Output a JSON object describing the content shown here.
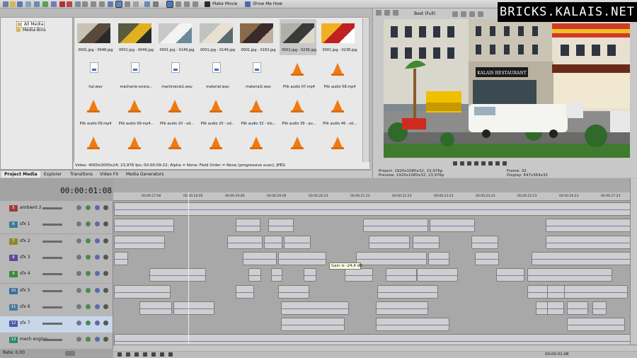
{
  "watermark": "BRICKS.KALAIS.NET",
  "toolbar": {
    "make_movie": "Make Movie",
    "show_me_how": "Show Me How"
  },
  "preview_toolbar": {
    "quality": "Best (Full)"
  },
  "tree": {
    "items": [
      "All Media",
      "Media Bins"
    ]
  },
  "media": {
    "items": [
      {
        "name": "0001.jpg - 0048.jpg",
        "kind": "thumb"
      },
      {
        "name": "0001.jpg - 0049.jpg",
        "kind": "thumb"
      },
      {
        "name": "0001.jpg - 0149.jpg",
        "kind": "thumb"
      },
      {
        "name": "0001.jpg - 0149.jpg",
        "kind": "thumb"
      },
      {
        "name": "0001.jpg - 0163.jpg",
        "kind": "thumb"
      },
      {
        "name": "0001.jpg - 0236.jpg",
        "kind": "thumb"
      },
      {
        "name": "0001.jpg - 0238.jpg",
        "kind": "thumb"
      },
      {
        "name": "hal.wav",
        "kind": "wav"
      },
      {
        "name": "machanie-sciera...",
        "kind": "wav"
      },
      {
        "name": "machniecie1.wav",
        "kind": "wav"
      },
      {
        "name": "material.wav",
        "kind": "wav"
      },
      {
        "name": "material2.wav",
        "kind": "wav"
      },
      {
        "name": "Plik audio 07.mp4",
        "kind": "cone"
      },
      {
        "name": "Plik audio 08.mp4",
        "kind": "cone"
      },
      {
        "name": "Plik audio 09.mp4",
        "kind": "cone"
      },
      {
        "name": "Plik audio 09.mp4...",
        "kind": "cone"
      },
      {
        "name": "Plik audio 20 - od...",
        "kind": "cone"
      },
      {
        "name": "Plik audio 20 - od...",
        "kind": "cone"
      },
      {
        "name": "Plik audio 32 - klo...",
        "kind": "cone"
      },
      {
        "name": "Plik audio 39 - pu...",
        "kind": "cone"
      },
      {
        "name": "Plik audio 46 - zd...",
        "kind": "cone"
      },
      {
        "name": "",
        "kind": "cone"
      },
      {
        "name": "",
        "kind": "cone"
      },
      {
        "name": "",
        "kind": "cone"
      },
      {
        "name": "",
        "kind": "cone"
      },
      {
        "name": "",
        "kind": "cone"
      },
      {
        "name": "",
        "kind": "cone"
      },
      {
        "name": "",
        "kind": "cone"
      }
    ],
    "status": "Video: 4000x3000x24; 23,976 fps; 00:00:09:22; Alpha = None; Field Order = None (progressive scan); JPEG"
  },
  "tabs": [
    "Project Media",
    "Explorer",
    "Transitions",
    "Video FX",
    "Media Generators"
  ],
  "preview": {
    "sign": "KALAIS RESTAURANT",
    "project": "Project:  1920x1080x32; 23,976p",
    "preview": "Preview:  1920x1080x32; 23,976p",
    "frame": "Frame:        32",
    "display": "Display:      647x364x32"
  },
  "timeline": {
    "timecode": "00:00:01:08",
    "ruler": [
      "00:00:17:00",
      "00:00:18:00",
      "00:00:19:00",
      "00:00:20:00",
      "00:00:20:23",
      "00:00:21:23",
      "00:00:22:23",
      "00:00:23:23",
      "00:00:24:23",
      "00:00:25:23",
      "00:00:26:23",
      "00:00:27:23"
    ],
    "tracks": [
      {
        "num": "5",
        "name": "ambient 2",
        "color": "#a03b3b"
      },
      {
        "num": "6",
        "name": "sfx 1",
        "color": "#3b7d9a"
      },
      {
        "num": "7",
        "name": "sfx 2",
        "color": "#8a8a2a"
      },
      {
        "num": "8",
        "name": "sfx 3",
        "color": "#5a4a9a"
      },
      {
        "num": "9",
        "name": "sfx 4",
        "color": "#3a8a3a"
      },
      {
        "num": "10",
        "name": "sfx 5",
        "color": "#3b6d9a"
      },
      {
        "num": "11",
        "name": "sfx 6",
        "color": "#4a7a9a"
      },
      {
        "num": "12",
        "name": "sfx 7",
        "color": "#4a5aa8"
      },
      {
        "num": "13",
        "name": "mech engine",
        "color": "#2d8a6a"
      }
    ],
    "gain_tooltip": "Gain is -24,4 dB",
    "rate": "Rate: 0,00",
    "end_time": "00:00:01:08"
  }
}
